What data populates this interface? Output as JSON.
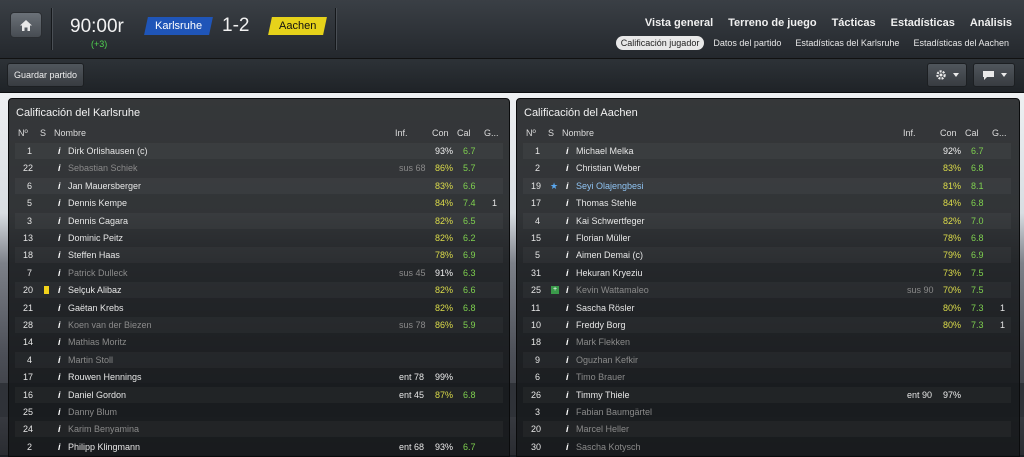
{
  "header": {
    "clock": "90:00r",
    "added_time": "(+3)",
    "home_team": "Karlsruhe",
    "away_team": "Aachen",
    "score": "1-2",
    "home_color": "#1f55b8",
    "away_color": "#e6d21a"
  },
  "nav": {
    "main": [
      "Vista general",
      "Terreno de juego",
      "Tácticas",
      "Estadísticas",
      "Análisis"
    ],
    "sub": [
      "Calificación jugador",
      "Datos del partido",
      "Estadísticas del Karlsruhe",
      "Estadísticas del Aachen"
    ],
    "active_sub": "Calificación jugador"
  },
  "toolbar": {
    "save_label": "Guardar partido",
    "settings_icon": "gear-icon",
    "chat_icon": "speech-bubble-icon"
  },
  "columns": {
    "no": "Nº",
    "s": "S",
    "name": "Nombre",
    "inf": "Inf.",
    "con": "Con",
    "cal": "Cal",
    "goals": "G..."
  },
  "panel_home": {
    "title": "Calificación del Karlsruhe",
    "rows": [
      {
        "no": "1",
        "s": "",
        "name": "Dirk Orlishausen (c)",
        "inf": "",
        "con": "93%",
        "cal": "6.7",
        "g": "",
        "dim": false
      },
      {
        "no": "22",
        "s": "",
        "name": "Sebastian Schiek",
        "inf": "sus 68",
        "con": "86%",
        "cal": "5.7",
        "g": "",
        "dim": true
      },
      {
        "no": "6",
        "s": "",
        "name": "Jan Mauersberger",
        "inf": "",
        "con": "83%",
        "cal": "6.6",
        "g": "",
        "dim": false
      },
      {
        "no": "5",
        "s": "",
        "name": "Dennis Kempe",
        "inf": "",
        "con": "84%",
        "cal": "7.4",
        "g": "1",
        "dim": false
      },
      {
        "no": "3",
        "s": "",
        "name": "Dennis Cagara",
        "inf": "",
        "con": "82%",
        "cal": "6.5",
        "g": "",
        "dim": false
      },
      {
        "no": "13",
        "s": "",
        "name": "Dominic Peitz",
        "inf": "",
        "con": "82%",
        "cal": "6.2",
        "g": "",
        "dim": false
      },
      {
        "no": "18",
        "s": "",
        "name": "Steffen Haas",
        "inf": "",
        "con": "78%",
        "cal": "6.9",
        "g": "",
        "dim": false
      },
      {
        "no": "7",
        "s": "",
        "name": "Patrick Dulleck",
        "inf": "sus 45",
        "con": "91%",
        "cal": "6.3",
        "g": "",
        "dim": true
      },
      {
        "no": "20",
        "s": "yellow-card",
        "name": "Selçuk Alibaz",
        "inf": "",
        "con": "82%",
        "cal": "6.6",
        "g": "",
        "dim": false
      },
      {
        "no": "21",
        "s": "",
        "name": "Gaëtan Krebs",
        "inf": "",
        "con": "82%",
        "cal": "6.8",
        "g": "",
        "dim": false
      },
      {
        "no": "28",
        "s": "",
        "name": "Koen van der Biezen",
        "inf": "sus 78",
        "con": "86%",
        "cal": "5.9",
        "g": "",
        "dim": true
      },
      {
        "no": "14",
        "s": "",
        "name": "Mathias Moritz",
        "inf": "",
        "con": "",
        "cal": "",
        "g": "",
        "dim": true
      },
      {
        "no": "4",
        "s": "",
        "name": "Martin Stoll",
        "inf": "",
        "con": "",
        "cal": "",
        "g": "",
        "dim": true
      },
      {
        "no": "17",
        "s": "",
        "name": "Rouwen Hennings",
        "inf": "ent 78",
        "con": "99%",
        "cal": "",
        "g": "",
        "dim": false
      },
      {
        "no": "16",
        "s": "",
        "name": "Daniel Gordon",
        "inf": "ent 45",
        "con": "87%",
        "cal": "6.8",
        "g": "",
        "dim": false
      },
      {
        "no": "25",
        "s": "",
        "name": "Danny Blum",
        "inf": "",
        "con": "",
        "cal": "",
        "g": "",
        "dim": true
      },
      {
        "no": "24",
        "s": "",
        "name": "Karim Benyamina",
        "inf": "",
        "con": "",
        "cal": "",
        "g": "",
        "dim": true
      },
      {
        "no": "2",
        "s": "",
        "name": "Philipp Klingmann",
        "inf": "ent 68",
        "con": "93%",
        "cal": "6.7",
        "g": "",
        "dim": false
      }
    ]
  },
  "panel_away": {
    "title": "Calificación del Aachen",
    "rows": [
      {
        "no": "1",
        "s": "",
        "name": "Michael Melka",
        "inf": "",
        "con": "92%",
        "cal": "6.7",
        "g": "",
        "dim": false
      },
      {
        "no": "2",
        "s": "",
        "name": "Christian Weber",
        "inf": "",
        "con": "83%",
        "cal": "6.8",
        "g": "",
        "dim": false
      },
      {
        "no": "19",
        "s": "star",
        "name": "Seyi Olajengbesi",
        "inf": "",
        "con": "81%",
        "cal": "8.1",
        "g": "",
        "dim": false,
        "highlight": true
      },
      {
        "no": "17",
        "s": "",
        "name": "Thomas Stehle",
        "inf": "",
        "con": "84%",
        "cal": "6.8",
        "g": "",
        "dim": false
      },
      {
        "no": "4",
        "s": "",
        "name": "Kai Schwertfeger",
        "inf": "",
        "con": "82%",
        "cal": "7.0",
        "g": "",
        "dim": false
      },
      {
        "no": "15",
        "s": "",
        "name": "Florian Müller",
        "inf": "",
        "con": "78%",
        "cal": "6.8",
        "g": "",
        "dim": false
      },
      {
        "no": "5",
        "s": "",
        "name": "Aimen Demai (c)",
        "inf": "",
        "con": "79%",
        "cal": "6.9",
        "g": "",
        "dim": false
      },
      {
        "no": "31",
        "s": "",
        "name": "Hekuran Kryeziu",
        "inf": "",
        "con": "73%",
        "cal": "7.5",
        "g": "",
        "dim": false
      },
      {
        "no": "25",
        "s": "injury",
        "name": "Kevin Wattamaleo",
        "inf": "sus 90",
        "con": "70%",
        "cal": "7.5",
        "g": "",
        "dim": true
      },
      {
        "no": "11",
        "s": "",
        "name": "Sascha Rösler",
        "inf": "",
        "con": "80%",
        "cal": "7.3",
        "g": "1",
        "dim": false
      },
      {
        "no": "10",
        "s": "",
        "name": "Freddy Borg",
        "inf": "",
        "con": "80%",
        "cal": "7.3",
        "g": "1",
        "dim": false
      },
      {
        "no": "18",
        "s": "",
        "name": "Mark Flekken",
        "inf": "",
        "con": "",
        "cal": "",
        "g": "",
        "dim": true
      },
      {
        "no": "9",
        "s": "",
        "name": "Oguzhan Kefkir",
        "inf": "",
        "con": "",
        "cal": "",
        "g": "",
        "dim": true
      },
      {
        "no": "6",
        "s": "",
        "name": "Timo Brauer",
        "inf": "",
        "con": "",
        "cal": "",
        "g": "",
        "dim": true
      },
      {
        "no": "26",
        "s": "",
        "name": "Timmy Thiele",
        "inf": "ent 90",
        "con": "97%",
        "cal": "",
        "g": "",
        "dim": false
      },
      {
        "no": "3",
        "s": "",
        "name": "Fabian Baumgärtel",
        "inf": "",
        "con": "",
        "cal": "",
        "g": "",
        "dim": true
      },
      {
        "no": "20",
        "s": "",
        "name": "Marcel Heller",
        "inf": "",
        "con": "",
        "cal": "",
        "g": "",
        "dim": true
      },
      {
        "no": "30",
        "s": "",
        "name": "Sascha Kotysch",
        "inf": "",
        "con": "",
        "cal": "",
        "g": "",
        "dim": true
      }
    ]
  }
}
